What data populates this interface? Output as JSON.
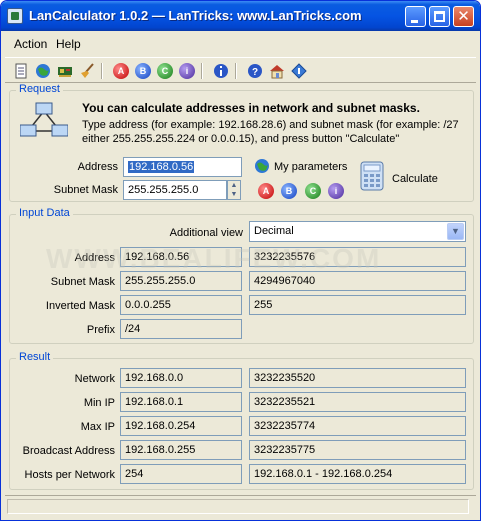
{
  "window": {
    "title": "LanCalculator 1.0.2 — LanTricks: www.LanTricks.com",
    "close_glyph": "✕"
  },
  "menu": {
    "items": [
      "Action",
      "Help"
    ]
  },
  "toolbar": {
    "icons": [
      "notepad-icon",
      "globe-icon",
      "network-card-icon",
      "broom-icon",
      "a-icon",
      "b-icon",
      "c-icon",
      "d-icon",
      "info-icon",
      "help-icon",
      "home-icon",
      "update-icon"
    ],
    "letters": {
      "a": "A",
      "b": "B",
      "c": "C",
      "d": "i"
    }
  },
  "request": {
    "title": "Request",
    "heading": "You can calculate addresses in network and subnet masks.",
    "description": "Type address (for example: 192.168.28.6) and subnet mask (for example: /27 either 255.255.255.224 or 0.0.0.15), and press button \"Calculate\"",
    "address_label": "Address",
    "address_value": "192.168.0.56",
    "mask_label": "Subnet Mask",
    "mask_value": "255.255.255.0",
    "my_parameters_label": "My parameters",
    "calculate_label": "Calculate"
  },
  "input_data": {
    "title": "Input Data",
    "additional_view_label": "Additional view",
    "additional_view_value": "Decimal",
    "rows": [
      {
        "label": "Address",
        "value": "192.168.0.56",
        "alt": "3232235576"
      },
      {
        "label": "Subnet Mask",
        "value": "255.255.255.0",
        "alt": "4294967040"
      },
      {
        "label": "Inverted Mask",
        "value": "0.0.0.255",
        "alt": "255"
      },
      {
        "label": "Prefix",
        "value": "/24"
      }
    ]
  },
  "result": {
    "title": "Result",
    "rows": [
      {
        "label": "Network",
        "value": "192.168.0.0",
        "alt": "3232235520"
      },
      {
        "label": "Min IP",
        "value": "192.168.0.1",
        "alt": "3232235521"
      },
      {
        "label": "Max IP",
        "value": "192.168.0.254",
        "alt": "3232235774"
      },
      {
        "label": "Broadcast Address",
        "value": "192.168.0.255",
        "alt": "3232235775"
      },
      {
        "label": "Hosts per Network",
        "value": "254",
        "alt": "192.168.0.1 - 192.168.0.254"
      }
    ]
  },
  "watermark": "WWW.BEALIFEW.COM"
}
